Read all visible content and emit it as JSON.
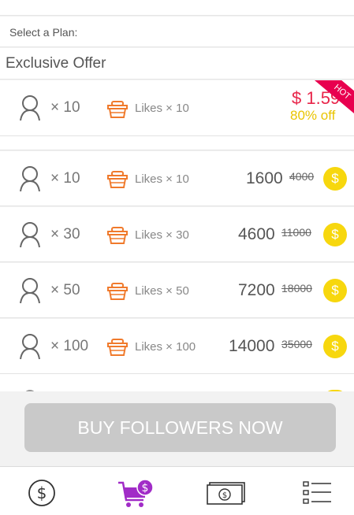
{
  "header": {
    "select_plan_label": "Select a Plan:"
  },
  "exclusive": {
    "title": "Exclusive Offer",
    "qty": "× 10",
    "likes": "Likes × 10",
    "price": "$ 1.59",
    "discount": "80% off",
    "ribbon": "HOT",
    "price_color": "#e8264a",
    "discount_color": "#e9c400",
    "ribbon_color": "#e8004f"
  },
  "plans": [
    {
      "qty": "× 10",
      "likes": "Likes × 10",
      "price": "1600",
      "old_price": "4000"
    },
    {
      "qty": "× 30",
      "likes": "Likes × 30",
      "price": "4600",
      "old_price": "11000"
    },
    {
      "qty": "× 50",
      "likes": "Likes × 50",
      "price": "7200",
      "old_price": "18000"
    },
    {
      "qty": "× 100",
      "likes": "Likes × 100",
      "price": "14000",
      "old_price": "35000"
    }
  ],
  "coin_symbol": "$",
  "buy_button_label": "BUY FOLLOWERS NOW",
  "nav": [
    {
      "icon": "coin-dollar-icon",
      "active": false
    },
    {
      "icon": "cart-coin-icon",
      "active": true
    },
    {
      "icon": "banknote-icon",
      "active": false
    },
    {
      "icon": "list-icon",
      "active": false
    }
  ],
  "colors": {
    "accent_purple": "#a12cc7",
    "coin": "#f7d70e",
    "basket": "#f07a2c"
  }
}
